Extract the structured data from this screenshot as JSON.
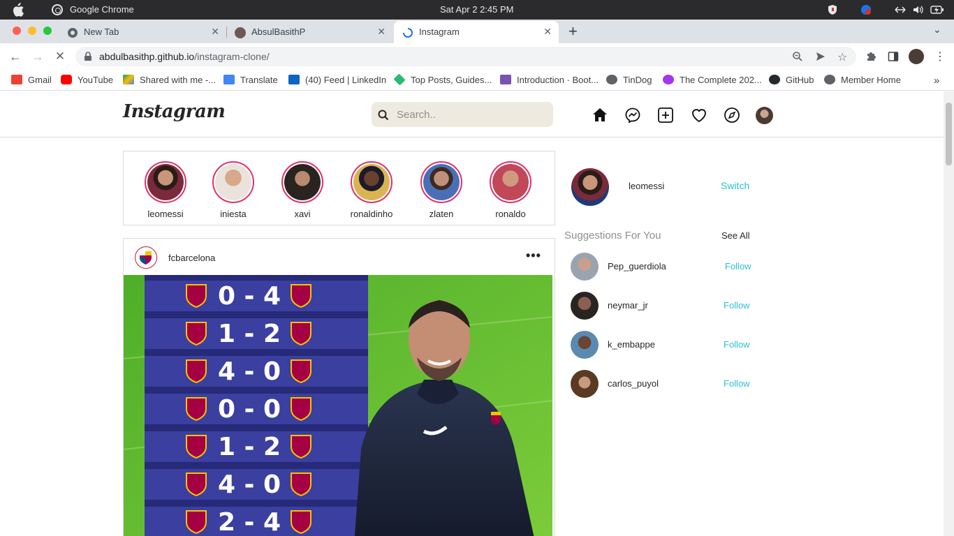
{
  "os": {
    "app_name": "Google Chrome",
    "datetime": "Sat Apr 2   2:45 PM"
  },
  "tabs": [
    {
      "label": "New Tab",
      "active": false
    },
    {
      "label": "AbsulBasithP",
      "active": false
    },
    {
      "label": "Instagram",
      "active": true
    }
  ],
  "toolbar": {
    "url_host": "abdulbasithp.github.io",
    "url_path": "/instagram-clone/"
  },
  "bookmarks": [
    {
      "label": "Gmail",
      "icon": "gmail-icon",
      "color": "#ea4335"
    },
    {
      "label": "YouTube",
      "icon": "youtube-icon",
      "color": "#ff0000"
    },
    {
      "label": "Shared with me -...",
      "icon": "drive-icon",
      "color": "#fbbc04"
    },
    {
      "label": "Translate",
      "icon": "translate-icon",
      "color": "#4285f4"
    },
    {
      "label": "(40) Feed | LinkedIn",
      "icon": "linkedin-icon",
      "color": "#0a66c2"
    },
    {
      "label": "Top Posts, Guides...",
      "icon": "gitlab-icon",
      "color": "#2eb872"
    },
    {
      "label": "Introduction · Boot...",
      "icon": "bootstrap-icon",
      "color": "#7952b3"
    },
    {
      "label": "TinDog",
      "icon": "globe-icon",
      "color": "#5f6368"
    },
    {
      "label": "The Complete 202...",
      "icon": "udemy-icon",
      "color": "#a435f0"
    },
    {
      "label": "GitHub",
      "icon": "github-icon",
      "color": "#24292e"
    },
    {
      "label": "Member Home",
      "icon": "globe-icon",
      "color": "#5f6368"
    }
  ],
  "ig": {
    "logo": "Instagram",
    "search_placeholder": "Search..",
    "stories": [
      {
        "name": "leomessi",
        "color": "#7a2a3a"
      },
      {
        "name": "iniesta",
        "color": "#b87a5a"
      },
      {
        "name": "xavi",
        "color": "#3c2f2a"
      },
      {
        "name": "ronaldinho",
        "color": "#d9b450"
      },
      {
        "name": "zlaten",
        "color": "#5a6fa8"
      },
      {
        "name": "ronaldo",
        "color": "#b85060"
      }
    ],
    "post": {
      "username": "fcbarcelona",
      "more": "•••",
      "results": [
        {
          "score": "0 - 4"
        },
        {
          "score": "1 - 2"
        },
        {
          "score": "4 - 0"
        },
        {
          "score": "0 - 0"
        },
        {
          "score": "1 - 2"
        },
        {
          "score": "4 - 0"
        },
        {
          "score": "2 - 4"
        }
      ]
    },
    "profile": {
      "username": "leomessi",
      "switch_label": "Switch"
    },
    "suggestions_title": "Suggestions For You",
    "see_all": "See All",
    "suggestions": [
      {
        "username": "Pep_guerdiola",
        "action": "Follow",
        "color": "#9aa4b0"
      },
      {
        "username": "neymar_jr",
        "action": "Follow",
        "color": "#3a2f2a"
      },
      {
        "username": "k_embappe",
        "action": "Follow",
        "color": "#5a8ab0"
      },
      {
        "username": "carlos_puyol",
        "action": "Follow",
        "color": "#7a5a3a"
      }
    ],
    "colors": {
      "accent": "#2bbfd1",
      "story_ring": "#e1306c",
      "search_bg": "#efeadf"
    }
  }
}
